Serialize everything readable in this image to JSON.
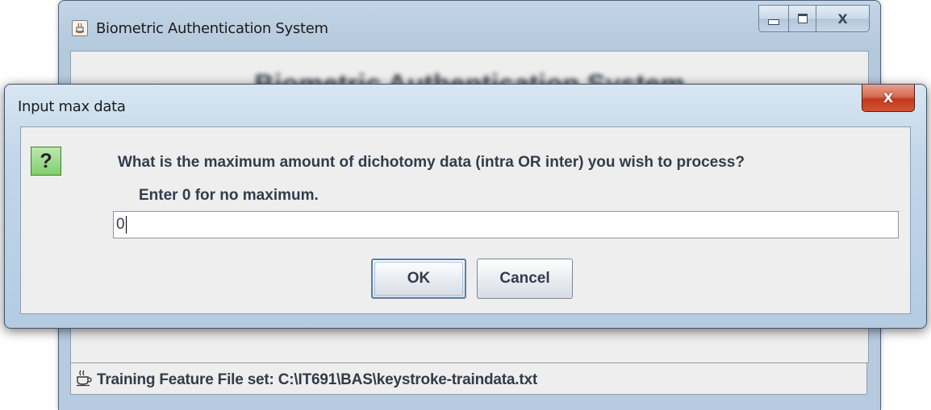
{
  "main_window": {
    "title": "Biometric Authentication System",
    "header_text": "Biometric Authentication System",
    "controls": {
      "minimize": "minimize",
      "maximize": "maximize",
      "close": "close"
    }
  },
  "status_bar": {
    "text": "Training Feature File set: C:\\IT691\\BAS\\keystroke-traindata.txt",
    "icon": "coffee-cup-icon"
  },
  "dialog": {
    "title": "Input max data",
    "icon": "question-icon",
    "icon_glyph": "?",
    "message_line1": "What is the maximum amount of dichotomy data (intra OR inter) you wish to process?",
    "message_line2": "Enter 0 for no maximum.",
    "input_value": "0",
    "ok_label": "OK",
    "cancel_label": "Cancel",
    "close_glyph": "X"
  },
  "colors": {
    "dialog_close": "#c2391f",
    "question_icon_bg": "#7fcf6c",
    "titlebar": "#b5c9dd"
  }
}
